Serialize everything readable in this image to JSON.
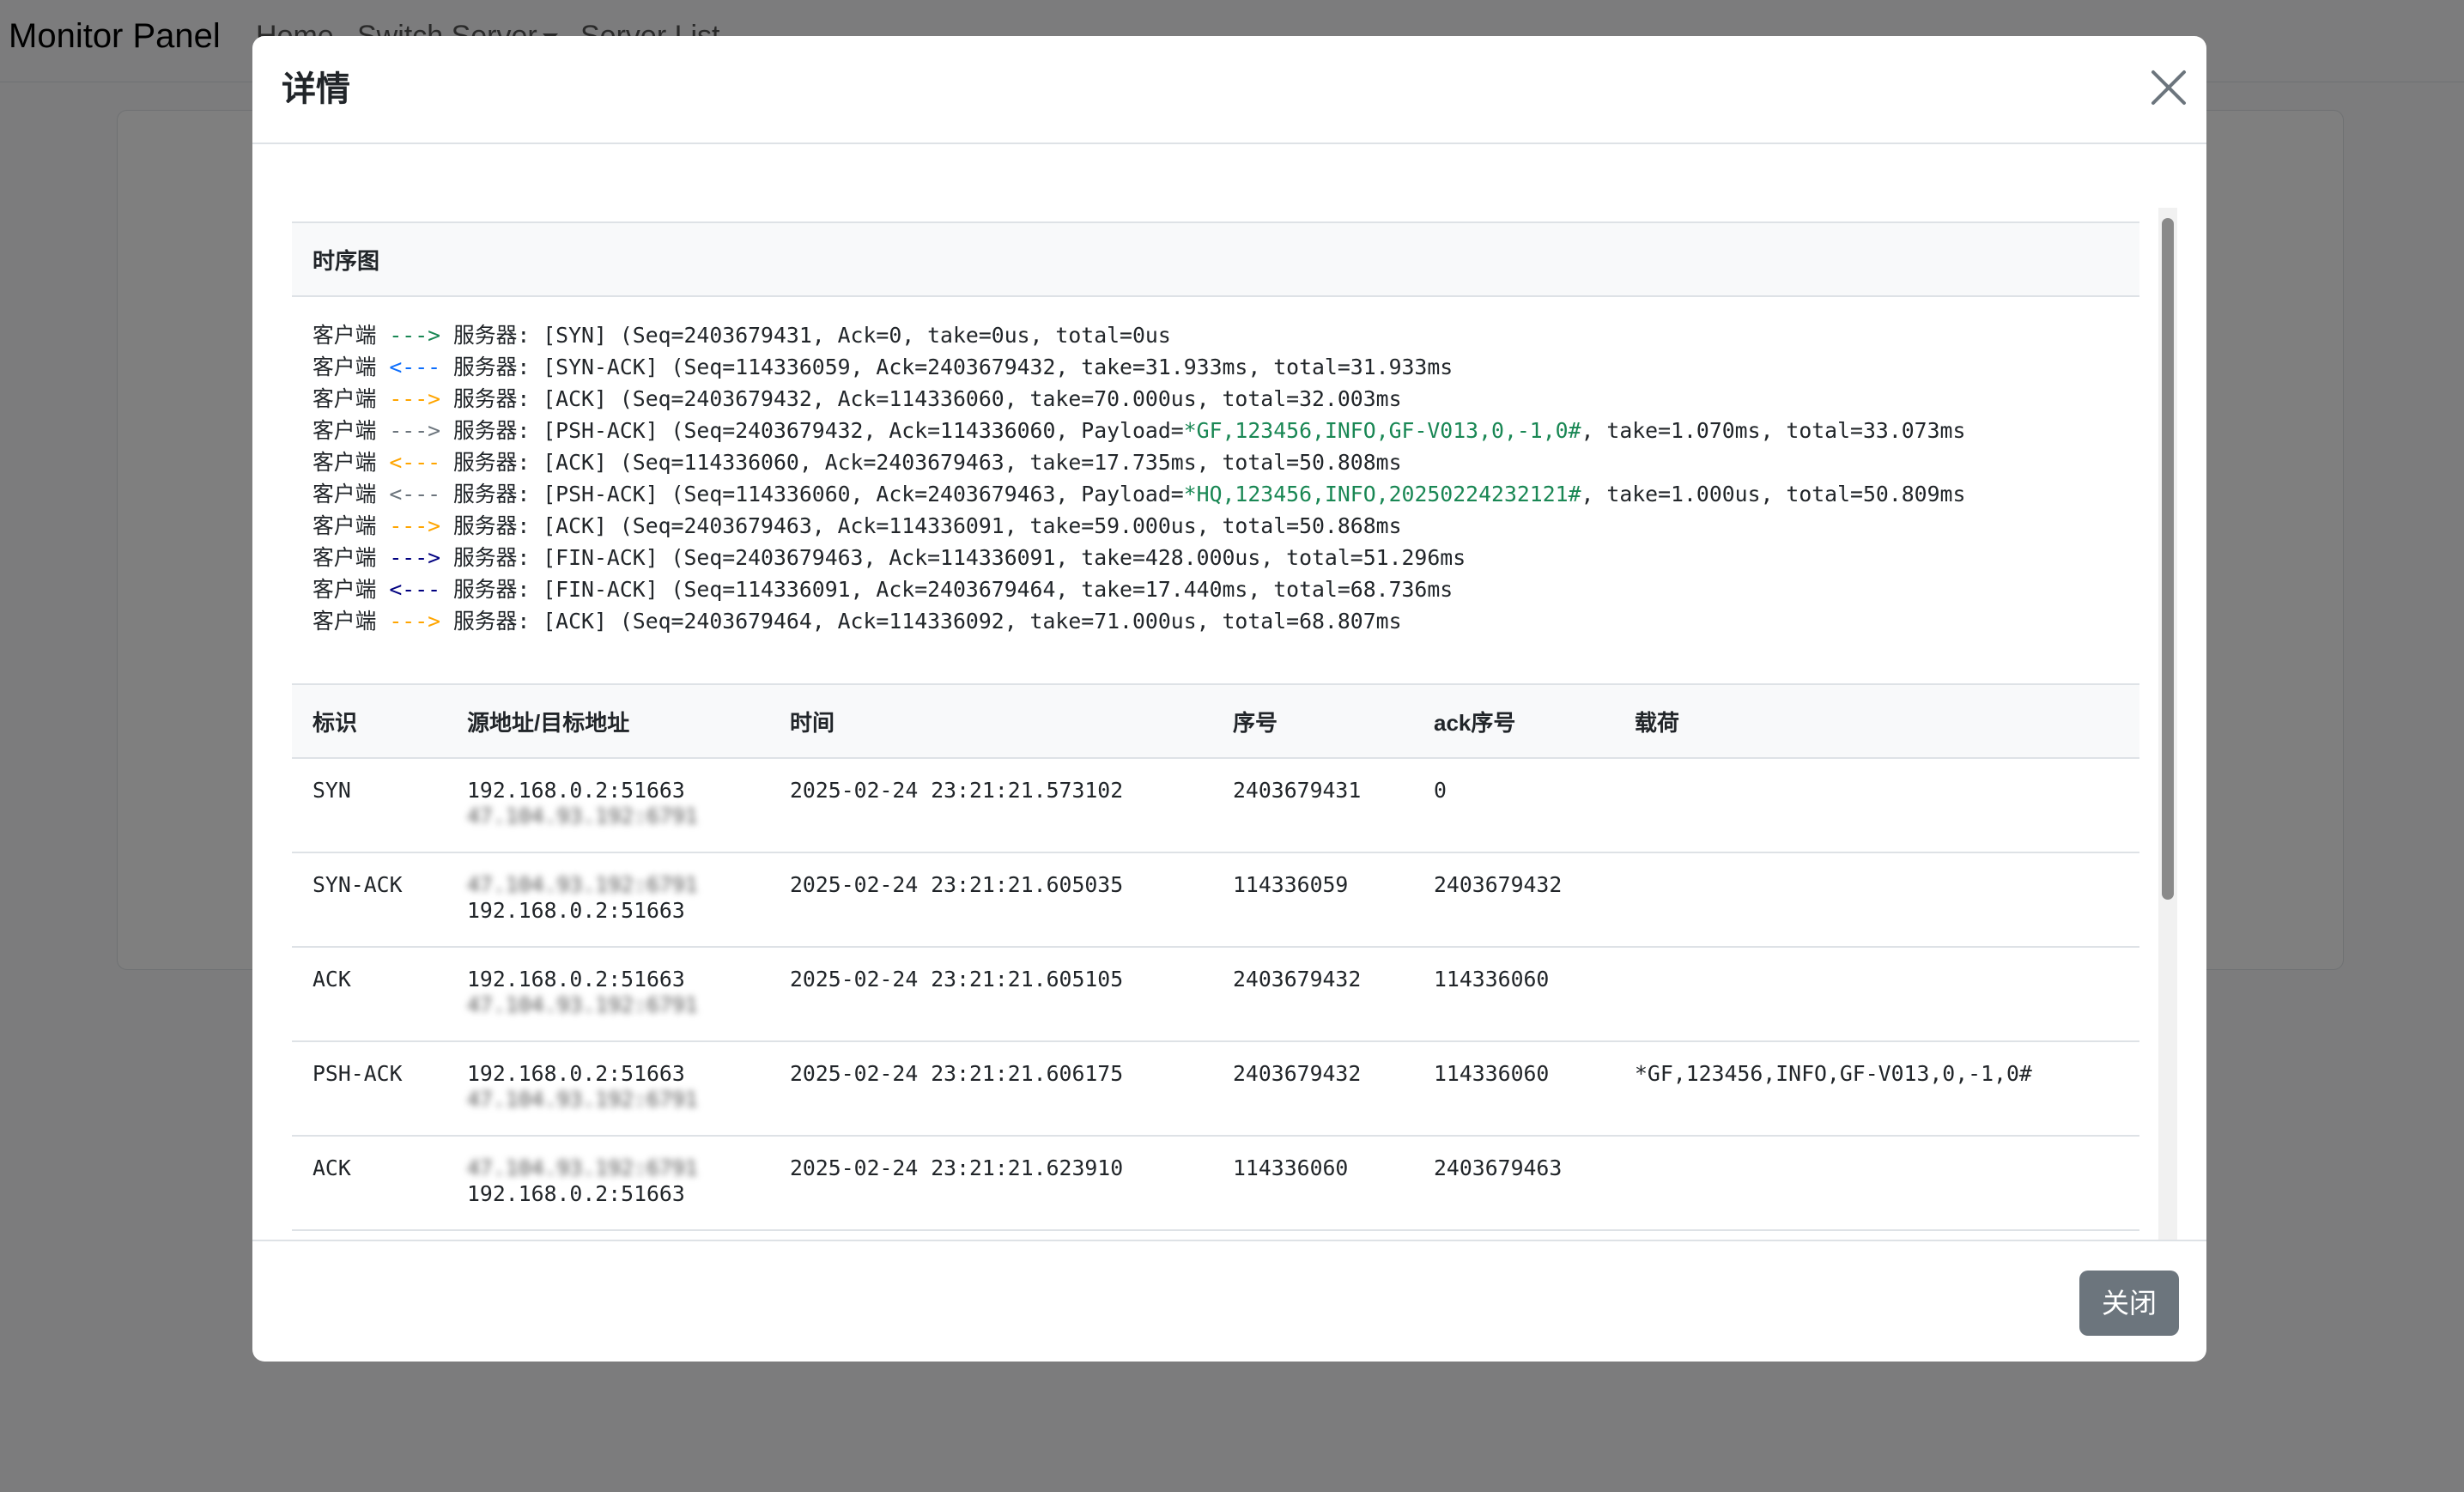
{
  "navbar": {
    "brand": "Monitor Panel",
    "links": [
      "Home",
      "Switch Server",
      "Server List"
    ]
  },
  "modal": {
    "title": "详情",
    "close_button": "关闭"
  },
  "sequence": {
    "title": "时序图",
    "lines": [
      {
        "client": "客户端",
        "arrow": "--->",
        "arrow_color": "#198754",
        "server": "服务器:",
        "pre": " [SYN] (Seq=2403679431, Ack=0, take=0us, total=0us",
        "payload": "",
        "post": ""
      },
      {
        "client": "客户端",
        "arrow": "<---",
        "arrow_color": "#0d6efd",
        "server": "服务器:",
        "pre": " [SYN-ACK] (Seq=114336059, Ack=2403679432, take=31.933ms, total=31.933ms",
        "payload": "",
        "post": ""
      },
      {
        "client": "客户端",
        "arrow": "--->",
        "arrow_color": "#ffa500",
        "server": "服务器:",
        "pre": " [ACK] (Seq=2403679432, Ack=114336060, take=70.000us, total=32.003ms",
        "payload": "",
        "post": ""
      },
      {
        "client": "客户端",
        "arrow": "--->",
        "arrow_color": "#6c757d",
        "server": "服务器:",
        "pre": " [PSH-ACK] (Seq=2403679432, Ack=114336060, Payload=",
        "payload": "*GF,123456,INFO,GF-V013,0,-1,0#",
        "post": ", take=1.070ms, total=33.073ms"
      },
      {
        "client": "客户端",
        "arrow": "<---",
        "arrow_color": "#ffa500",
        "server": "服务器:",
        "pre": " [ACK] (Seq=114336060, Ack=2403679463, take=17.735ms, total=50.808ms",
        "payload": "",
        "post": ""
      },
      {
        "client": "客户端",
        "arrow": "<---",
        "arrow_color": "#6c757d",
        "server": "服务器:",
        "pre": " [PSH-ACK] (Seq=114336060, Ack=2403679463, Payload=",
        "payload": "*HQ,123456,INFO,20250224232121#",
        "post": ", take=1.000us, total=50.809ms"
      },
      {
        "client": "客户端",
        "arrow": "--->",
        "arrow_color": "#ffa500",
        "server": "服务器:",
        "pre": " [ACK] (Seq=2403679463, Ack=114336091, take=59.000us, total=50.868ms",
        "payload": "",
        "post": ""
      },
      {
        "client": "客户端",
        "arrow": "--->",
        "arrow_color": "#000080",
        "server": "服务器:",
        "pre": " [FIN-ACK] (Seq=2403679463, Ack=114336091, take=428.000us, total=51.296ms",
        "payload": "",
        "post": ""
      },
      {
        "client": "客户端",
        "arrow": "<---",
        "arrow_color": "#000080",
        "server": "服务器:",
        "pre": " [FIN-ACK] (Seq=114336091, Ack=2403679464, take=17.440ms, total=68.736ms",
        "payload": "",
        "post": ""
      },
      {
        "client": "客户端",
        "arrow": "--->",
        "arrow_color": "#ffa500",
        "server": "服务器:",
        "pre": " [ACK] (Seq=2403679464, Ack=114336092, take=71.000us, total=68.807ms",
        "payload": "",
        "post": ""
      }
    ],
    "payload_color": "#198754"
  },
  "table": {
    "headers": [
      "标识",
      "源地址/目标地址",
      "时间",
      "序号",
      "ack序号",
      "载荷"
    ],
    "rows": [
      {
        "flag": "SYN",
        "addr1": "192.168.0.2:51663",
        "addr1_blurred": false,
        "addr2": "47.104.93.192:6791",
        "addr2_blurred": true,
        "time": "2025-02-24 23:21:21.573102",
        "seq": "2403679431",
        "ack": "0",
        "payload": ""
      },
      {
        "flag": "SYN-ACK",
        "addr1": "47.104.93.192:6791",
        "addr1_blurred": true,
        "addr2": "192.168.0.2:51663",
        "addr2_blurred": false,
        "time": "2025-02-24 23:21:21.605035",
        "seq": "114336059",
        "ack": "2403679432",
        "payload": ""
      },
      {
        "flag": "ACK",
        "addr1": "192.168.0.2:51663",
        "addr1_blurred": false,
        "addr2": "47.104.93.192:6791",
        "addr2_blurred": true,
        "time": "2025-02-24 23:21:21.605105",
        "seq": "2403679432",
        "ack": "114336060",
        "payload": ""
      },
      {
        "flag": "PSH-ACK",
        "addr1": "192.168.0.2:51663",
        "addr1_blurred": false,
        "addr2": "47.104.93.192:6791",
        "addr2_blurred": true,
        "time": "2025-02-24 23:21:21.606175",
        "seq": "2403679432",
        "ack": "114336060",
        "payload": "*GF,123456,INFO,GF-V013,0,-1,0#"
      },
      {
        "flag": "ACK",
        "addr1": "47.104.93.192:6791",
        "addr1_blurred": true,
        "addr2": "192.168.0.2:51663",
        "addr2_blurred": false,
        "time": "2025-02-24 23:21:21.623910",
        "seq": "114336060",
        "ack": "2403679463",
        "payload": ""
      }
    ]
  }
}
